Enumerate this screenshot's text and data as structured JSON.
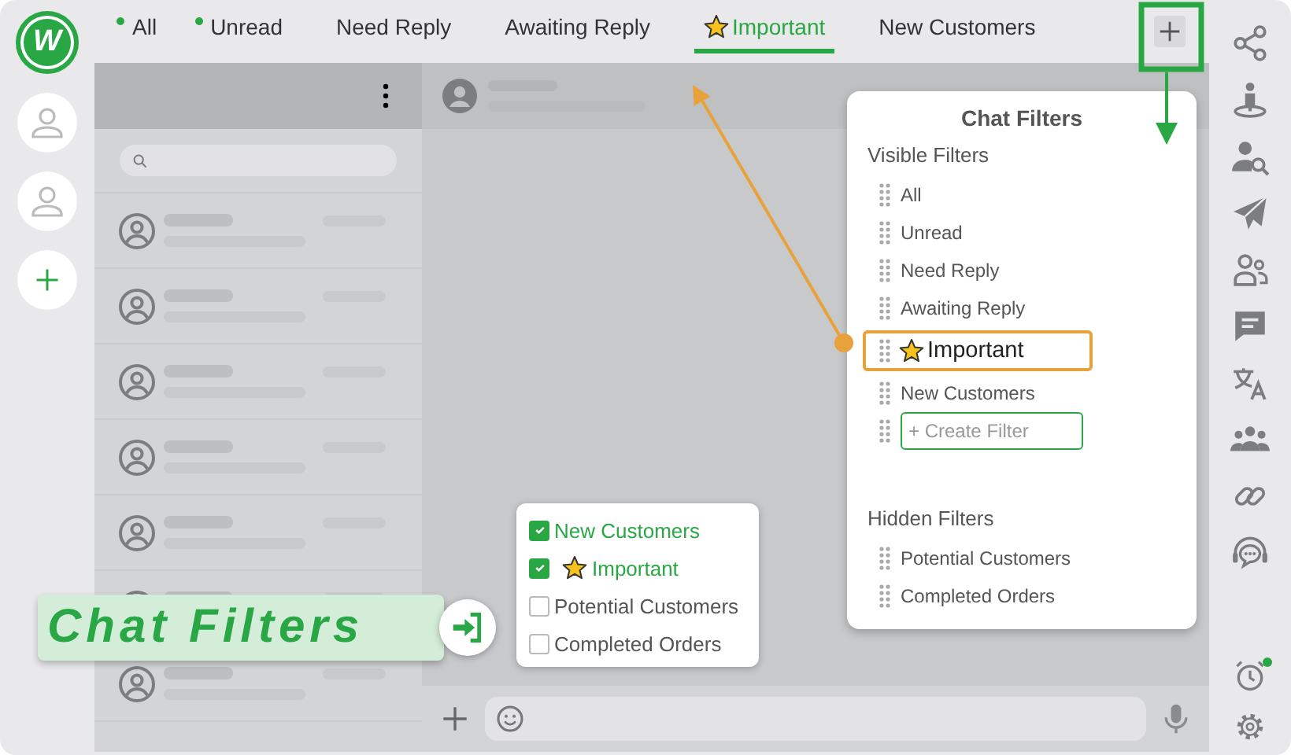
{
  "logo": "W",
  "tabs": [
    {
      "label": "All",
      "selected": false,
      "dot": true,
      "starred": false
    },
    {
      "label": "Unread",
      "selected": false,
      "dot": true,
      "starred": false
    },
    {
      "label": "Need Reply",
      "selected": false,
      "dot": false,
      "starred": false
    },
    {
      "label": "Awaiting Reply",
      "selected": false,
      "dot": false,
      "starred": false
    },
    {
      "label": "Important",
      "selected": true,
      "dot": false,
      "starred": true
    },
    {
      "label": "New Customers",
      "selected": false,
      "dot": false,
      "starred": false
    }
  ],
  "filter_popup": {
    "title": "Chat Filters",
    "visible_heading": "Visible Filters",
    "visible_filters": [
      {
        "label": "All",
        "starred": false,
        "highlighted": false
      },
      {
        "label": "Unread",
        "starred": false,
        "highlighted": false
      },
      {
        "label": "Need Reply",
        "starred": false,
        "highlighted": false
      },
      {
        "label": "Awaiting Reply",
        "starred": false,
        "highlighted": false
      },
      {
        "label": "Important",
        "starred": true,
        "highlighted": true
      },
      {
        "label": "New Customers",
        "starred": false,
        "highlighted": false
      }
    ],
    "create_filter": {
      "placeholder": "+ Create Filter"
    },
    "hidden_heading": "Hidden Filters",
    "hidden_filters": [
      {
        "label": "Potential Customers"
      },
      {
        "label": "Completed Orders"
      }
    ]
  },
  "checklist": [
    {
      "label": "New Customers",
      "checked": true,
      "starred": false
    },
    {
      "label": "Important",
      "checked": true,
      "starred": true
    },
    {
      "label": "Potential Customers",
      "checked": false,
      "starred": false
    },
    {
      "label": "Completed Orders",
      "checked": false,
      "starred": false
    }
  ],
  "banner": {
    "title": "Chat Filters"
  },
  "right_sidebar": {
    "alarm_badge": true
  }
}
